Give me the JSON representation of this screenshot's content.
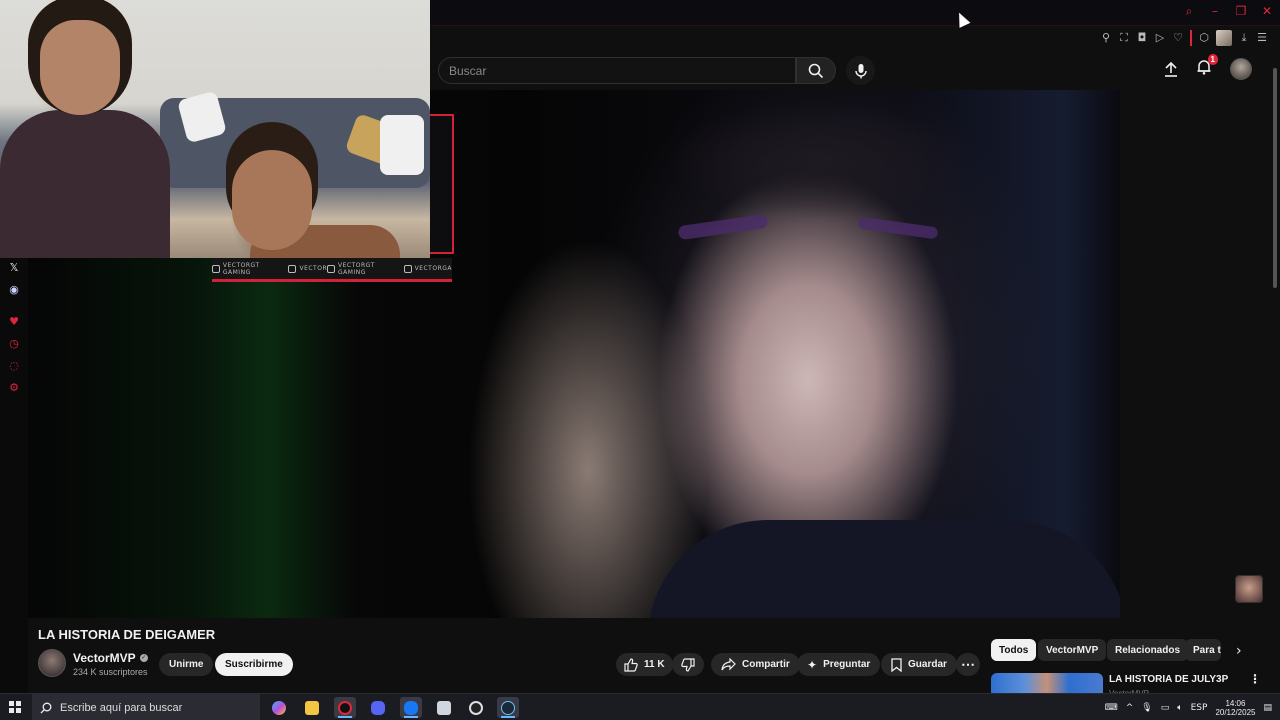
{
  "browser": {
    "window_controls": [
      "search-icon",
      "minimize-icon",
      "restore-icon",
      "close-icon"
    ],
    "extensions": [
      "pin-icon",
      "crop-icon",
      "pocket-icon",
      "play-icon",
      "heart-icon",
      "extension-icon",
      "avatar",
      "download-icon",
      "menu-icon"
    ]
  },
  "header": {
    "search_placeholder": "Buscar",
    "notification_count": "1"
  },
  "webcam": {
    "socials": [
      {
        "icon": "youtube-icon",
        "label": "VECTORGT GAMING"
      },
      {
        "icon": "twitch-icon",
        "label": "VECTOR"
      },
      {
        "icon": "twitter-icon",
        "label": "VECTORGT GAMING"
      },
      {
        "icon": "instagram-icon",
        "label": "VECTORGA"
      }
    ]
  },
  "left_rail": {
    "items": [
      "x-icon",
      "discord-icon",
      "heart-icon",
      "history-icon",
      "chat-icon",
      "settings-icon"
    ]
  },
  "video": {
    "title": "LA HISTORIA DE DEIGAMER",
    "channel": "VectorMVP",
    "subscribers": "234 K suscriptores",
    "join_label": "Unirme",
    "subscribe_label": "Suscribirme",
    "like_count": "11 K",
    "share_label": "Compartir",
    "ask_label": "Preguntar",
    "save_label": "Guardar"
  },
  "chips": [
    "Todos",
    "VectorMVP",
    "Relacionados",
    "Para ti"
  ],
  "related": {
    "title": "LA HISTORIA DE  JULY3P",
    "channel": "VectorMVP"
  },
  "taskbar": {
    "search_placeholder": "Escribe aquí para buscar",
    "language": "ESP",
    "time": "14:06",
    "date": "20/12/2025"
  },
  "colors": {
    "accent_red": "#e0263b",
    "yt_bg": "#0f0f0f",
    "chip_dark": "#272727"
  }
}
